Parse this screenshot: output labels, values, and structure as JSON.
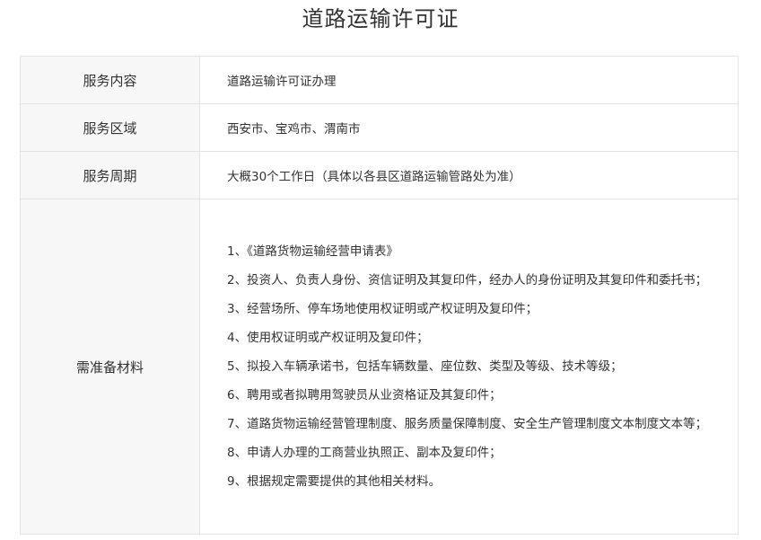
{
  "page": {
    "title": "道路运输许可证"
  },
  "rows": [
    {
      "label": "服务内容",
      "value": "道路运输许可证办理"
    },
    {
      "label": "服务区域",
      "value": "西安市、宝鸡市、渭南市"
    },
    {
      "label": "服务周期",
      "value": "大概30个工作日（具体以各县区道路运输管路处为准）"
    }
  ],
  "materials": {
    "label": "需准备材料",
    "items": [
      "1、《道路货物运输经营申请表》",
      "2、投资人、负责人身份、资信证明及其复印件，经办人的身份证明及其复印件和委托书；",
      "3、经营场所、停车场地使用权证明或产权证明及复印件；",
      "4、使用权证明或产权证明及复印件；",
      "5、拟投入车辆承诺书，包括车辆数量、座位数、类型及等级、技术等级；",
      "6、聘用或者拟聘用驾驶员从业资格证及其复印件；",
      "7、道路货物运输经营管理制度、服务质量保障制度、安全生产管理制度文本制度文本等；",
      "8、申请人办理的工商营业执照正、副本及复印件；",
      "9、根据规定需要提供的其他相关材料。"
    ]
  }
}
